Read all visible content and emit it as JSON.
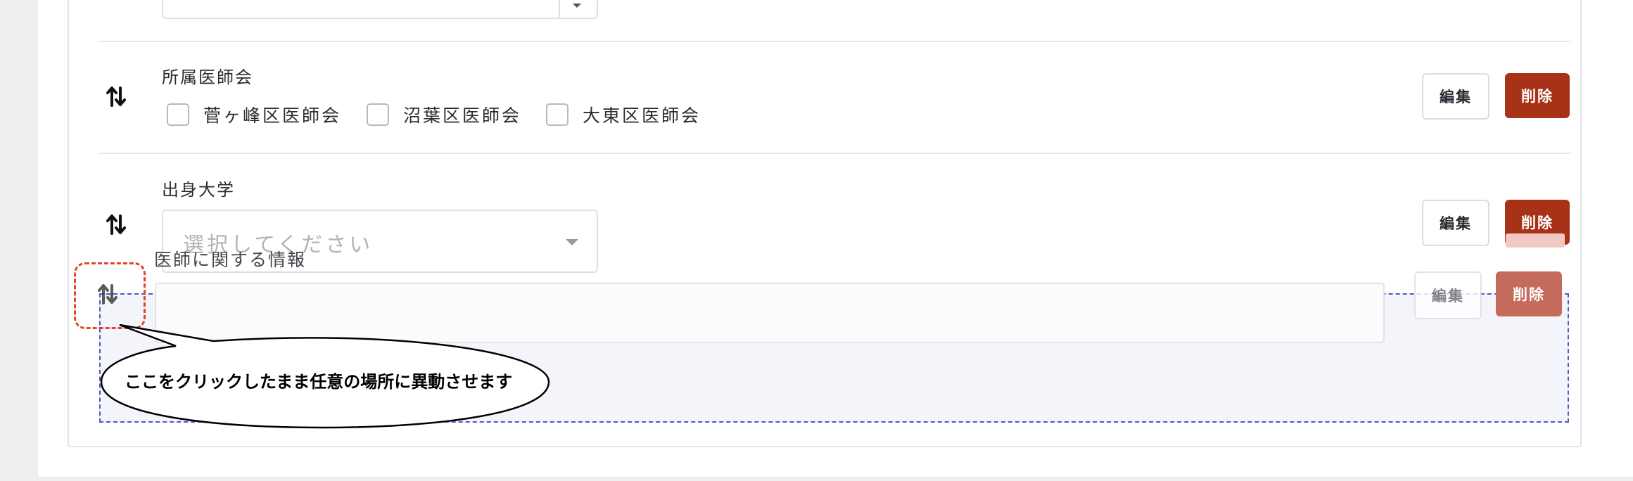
{
  "rows": [
    {
      "label": "所属医師会",
      "checkboxes": [
        "菅ヶ峰区医師会",
        "沼葉区医師会",
        "大東区医師会"
      ],
      "edit_label": "編集",
      "delete_label": "削除"
    },
    {
      "label": "出身大学",
      "placeholder": "選択してください",
      "edit_label": "編集",
      "delete_label": "削除"
    }
  ],
  "dragging_item": {
    "label": "医師に関する情報",
    "edit_label": "編集",
    "delete_label": "削除"
  },
  "annotation": {
    "callout_text": "ここをクリックしたまま任意の場所に異動させます",
    "highlight_color": "#e0452a"
  },
  "colors": {
    "delete_button": "#a83217",
    "drop_zone_border": "#4d59c7"
  },
  "icons": [
    "move-handle-icon",
    "chevron-down-icon"
  ]
}
